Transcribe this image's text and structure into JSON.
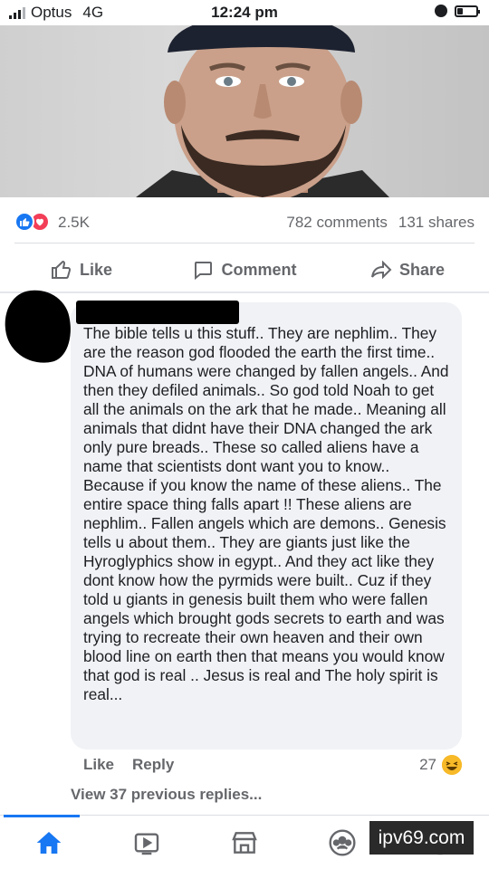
{
  "status_bar": {
    "carrier": "Optus",
    "network": "4G",
    "time": "12:24 pm"
  },
  "post": {
    "reaction_count": "2.5K",
    "comments_count": "782 comments",
    "shares_count": "131 shares",
    "reaction_icons": [
      "like-icon",
      "love-icon"
    ],
    "actions": {
      "like_label": "Like",
      "comment_label": "Comment",
      "share_label": "Share"
    }
  },
  "comment": {
    "text": "The bible tells u this stuff.. They are nephlim.. They are the reason god flooded the earth the first time.. DNA of humans were changed by fallen angels.. And then they defiled animals.. So god told Noah to get all the animals on the ark that he made.. Meaning all animals that didnt have their DNA changed the ark only pure breads.. These so called aliens have a name that scientists dont want you to know.. Because if you know the name of these aliens.. The entire space thing falls apart !! These aliens are nephlim.. Fallen angels which are demons.. Genesis tells u about them.. They are giants just like the Hyroglyphics show in egypt.. And they act like they dont know how the pyrmids were built.. Cuz if they told u giants in genesis built them who were fallen angels which brought gods secrets to earth and was trying to recreate their own heaven and their own blood line on earth then that means you would know that god is real .. Jesus is real and The holy spirit is real...",
    "like_label": "Like",
    "reply_label": "Reply",
    "reaction_count": "27",
    "reaction_icon": "haha-icon",
    "view_replies": "View 37 previous replies..."
  },
  "tab_bar": {
    "tabs": [
      "home-icon",
      "watch-icon",
      "marketplace-icon",
      "groups-icon",
      "notifications-icon"
    ]
  },
  "watermark": "ipv69.com",
  "colors": {
    "accent": "#1877f2",
    "love": "#f33e58",
    "secondary_text": "#65676b",
    "bubble": "#f0f2f5"
  }
}
